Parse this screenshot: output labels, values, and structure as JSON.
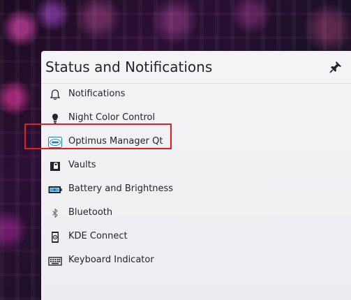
{
  "panel": {
    "title": "Status and Notifications",
    "pin_icon": "pin-icon"
  },
  "items": [
    {
      "label": "Notifications",
      "icon": "bell-icon"
    },
    {
      "label": "Night Color Control",
      "icon": "bulb-icon"
    },
    {
      "label": "Optimus Manager Qt",
      "icon": "intel-icon"
    },
    {
      "label": "Vaults",
      "icon": "vault-icon"
    },
    {
      "label": "Battery and Brightness",
      "icon": "battery-icon"
    },
    {
      "label": "Bluetooth",
      "icon": "bluetooth-icon"
    },
    {
      "label": "KDE Connect",
      "icon": "phone-icon"
    },
    {
      "label": "Keyboard Indicator",
      "icon": "keyboard-icon"
    }
  ],
  "annotation": {
    "highlight_color": "#e02020",
    "highlighted_item": "Optimus Manager Qt"
  }
}
